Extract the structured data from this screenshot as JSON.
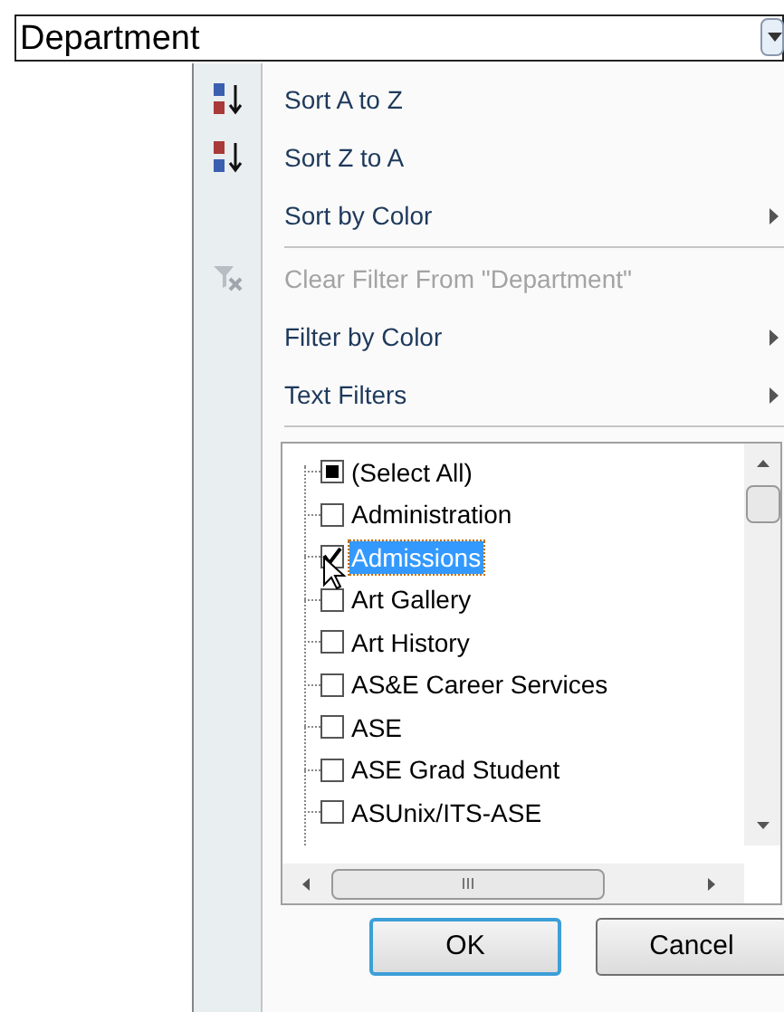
{
  "header_cell": {
    "value": "Department"
  },
  "menu": {
    "items": [
      {
        "kind": "sort_asc",
        "text": "Sort A to Z",
        "disabled": false,
        "submenu": false,
        "separator_after": false
      },
      {
        "kind": "sort_desc",
        "text": "Sort Z to A",
        "disabled": false,
        "submenu": false,
        "separator_after": false
      },
      {
        "kind": "plain",
        "text": "Sort by Color",
        "disabled": false,
        "submenu": true,
        "separator_after": true
      },
      {
        "kind": "clear_filter",
        "text": "Clear Filter From \"Department\"",
        "disabled": true,
        "submenu": false,
        "separator_after": false
      },
      {
        "kind": "plain",
        "text": "Filter by Color",
        "disabled": false,
        "submenu": true,
        "separator_after": false
      },
      {
        "kind": "plain",
        "text": "Text Filters",
        "disabled": false,
        "submenu": true,
        "separator_after": true
      }
    ]
  },
  "values_list": {
    "items": [
      {
        "kind": "mixed",
        "label": "(Select All)",
        "selected": false
      },
      {
        "kind": "unchecked",
        "label": "Administration",
        "selected": false
      },
      {
        "kind": "checked",
        "label": "Admissions",
        "selected": true
      },
      {
        "kind": "unchecked",
        "label": "Art Gallery",
        "selected": false
      },
      {
        "kind": "unchecked",
        "label": "Art History",
        "selected": false
      },
      {
        "kind": "unchecked",
        "label": "AS&E Career Services",
        "selected": false
      },
      {
        "kind": "unchecked",
        "label": "ASE",
        "selected": false
      },
      {
        "kind": "unchecked",
        "label": "ASE Grad Student",
        "selected": false
      },
      {
        "kind": "unchecked",
        "label": "ASUnix/ITS-ASE",
        "selected": false
      }
    ]
  },
  "buttons": [
    {
      "label": "OK",
      "default": true
    },
    {
      "label": "Cancel",
      "default": false
    }
  ]
}
